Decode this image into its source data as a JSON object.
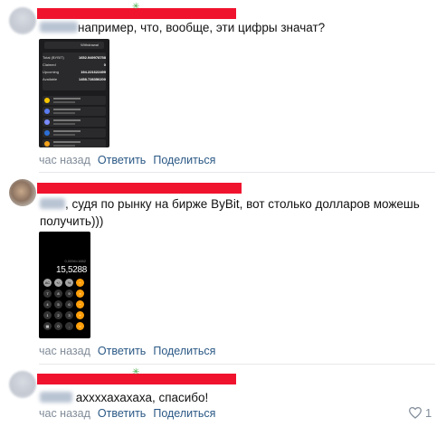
{
  "comments": [
    {
      "text": "например, что, вообще, эти цифры значат?",
      "time": "час назад",
      "reply": "Ответить",
      "share": "Поделиться"
    },
    {
      "text_line1": ", судя по рынку на бирже ByBit, вот столько долларов можешь",
      "text_line2": "получить)))",
      "time": "час назад",
      "reply": "Ответить",
      "share": "Поделиться"
    },
    {
      "text": "аххххахахаха, спасибо!",
      "time": "час назад",
      "reply": "Ответить",
      "share": "Поделиться",
      "likes": "1"
    }
  ],
  "screenshot1": {
    "tabs": [
      "",
      "Withdrawal"
    ],
    "rows": [
      {
        "label": "Total (BYBIT)",
        "value": "1652.949978758"
      },
      {
        "label": "Claimed",
        "value": "0"
      },
      {
        "label": "Upcoming",
        "value": "194.221622499"
      },
      {
        "label": "Available",
        "value": "1458.728356200"
      }
    ]
  },
  "calculator": {
    "expression": "0,0094×1652",
    "result": "15,5288",
    "keys": [
      "AC",
      "+/-",
      "%",
      "÷",
      "7",
      "8",
      "9",
      "×",
      "4",
      "5",
      "6",
      "−",
      "1",
      "2",
      "3",
      "+",
      "▦",
      "0",
      ",",
      "="
    ]
  },
  "colors": {
    "link": "#2a5885",
    "meta": "#818c99",
    "redact": "#f0132e",
    "calc_operator": "#ff9f0a"
  },
  "icons": {
    "like": "heart-outline-icon"
  }
}
